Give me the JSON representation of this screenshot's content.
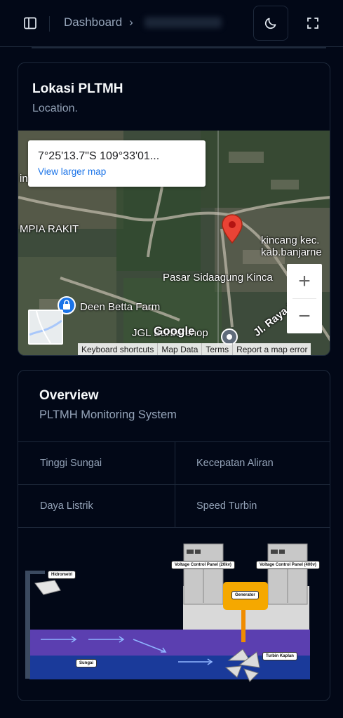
{
  "header": {
    "breadcrumb_root": "Dashboard",
    "breadcrumb_separator": "›"
  },
  "location_card": {
    "title": "Lokasi PLTMH",
    "subtitle": "Location."
  },
  "map": {
    "coordinate": "7°25'13.7\"S 109°33'01...",
    "view_larger": "View larger map",
    "places": {
      "mpia_rakit": "MPIA RAKIT",
      "kincang_1": "kincang kec.",
      "kincang_2": "kab.banjarne",
      "pasar": "Pasar Sidaagung Kinca",
      "deen": "Deen Betta Farm",
      "jgl": "JGL Barbershop",
      "jl_raya": "Jl. Raya P",
      "in": "in"
    },
    "google": "Google",
    "zoom_in": "+",
    "zoom_out": "−",
    "attribution": [
      "Keyboard shortcuts",
      "Map Data",
      "Terms",
      "Report a map error"
    ]
  },
  "overview_card": {
    "title": "Overview",
    "subtitle": "PLTMH Monitoring System",
    "metrics": [
      "Tinggi Sungai",
      "Kecepatan Aliran",
      "Daya Listrik",
      "Speed Turbin"
    ]
  },
  "diagram": {
    "hidrometri": "Hidrometri",
    "vcp_20kv": "Voltage Control Panel (20kv)",
    "vcp_400v": "Voltage Control Panel (400v)",
    "generator": "Generator",
    "turbin": "Turbin Kaplan",
    "sungai": "Sungai"
  },
  "colors": {
    "background": "#020817",
    "border": "#1e293b",
    "muted_text": "#94a3b8",
    "map_pin": "#ea4335",
    "link": "#1a73e8",
    "river_upper": "#5b3fb0",
    "river_lower": "#1a3a9a",
    "generator": "#f5a800"
  }
}
